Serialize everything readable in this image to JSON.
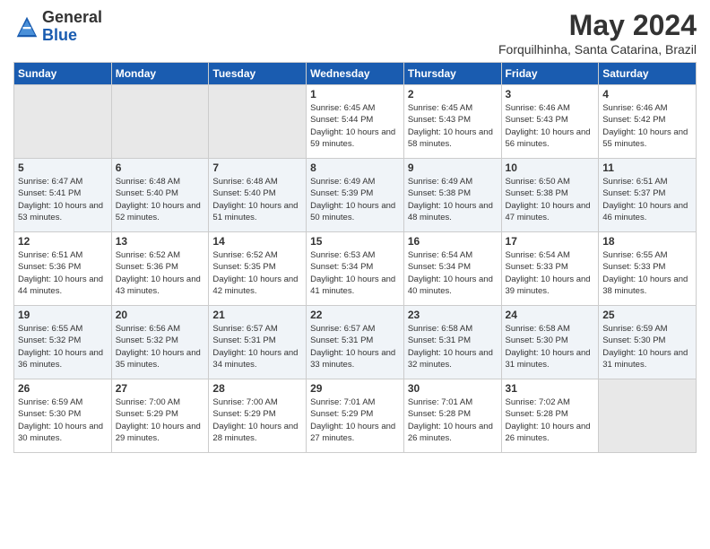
{
  "logo": {
    "general": "General",
    "blue": "Blue"
  },
  "title": {
    "month_year": "May 2024",
    "location": "Forquilhinha, Santa Catarina, Brazil"
  },
  "headers": [
    "Sunday",
    "Monday",
    "Tuesday",
    "Wednesday",
    "Thursday",
    "Friday",
    "Saturday"
  ],
  "weeks": [
    [
      {
        "day": "",
        "info": ""
      },
      {
        "day": "",
        "info": ""
      },
      {
        "day": "",
        "info": ""
      },
      {
        "day": "1",
        "info": "Sunrise: 6:45 AM\nSunset: 5:44 PM\nDaylight: 10 hours\nand 59 minutes."
      },
      {
        "day": "2",
        "info": "Sunrise: 6:45 AM\nSunset: 5:43 PM\nDaylight: 10 hours\nand 58 minutes."
      },
      {
        "day": "3",
        "info": "Sunrise: 6:46 AM\nSunset: 5:43 PM\nDaylight: 10 hours\nand 56 minutes."
      },
      {
        "day": "4",
        "info": "Sunrise: 6:46 AM\nSunset: 5:42 PM\nDaylight: 10 hours\nand 55 minutes."
      }
    ],
    [
      {
        "day": "5",
        "info": "Sunrise: 6:47 AM\nSunset: 5:41 PM\nDaylight: 10 hours\nand 53 minutes."
      },
      {
        "day": "6",
        "info": "Sunrise: 6:48 AM\nSunset: 5:40 PM\nDaylight: 10 hours\nand 52 minutes."
      },
      {
        "day": "7",
        "info": "Sunrise: 6:48 AM\nSunset: 5:40 PM\nDaylight: 10 hours\nand 51 minutes."
      },
      {
        "day": "8",
        "info": "Sunrise: 6:49 AM\nSunset: 5:39 PM\nDaylight: 10 hours\nand 50 minutes."
      },
      {
        "day": "9",
        "info": "Sunrise: 6:49 AM\nSunset: 5:38 PM\nDaylight: 10 hours\nand 48 minutes."
      },
      {
        "day": "10",
        "info": "Sunrise: 6:50 AM\nSunset: 5:38 PM\nDaylight: 10 hours\nand 47 minutes."
      },
      {
        "day": "11",
        "info": "Sunrise: 6:51 AM\nSunset: 5:37 PM\nDaylight: 10 hours\nand 46 minutes."
      }
    ],
    [
      {
        "day": "12",
        "info": "Sunrise: 6:51 AM\nSunset: 5:36 PM\nDaylight: 10 hours\nand 44 minutes."
      },
      {
        "day": "13",
        "info": "Sunrise: 6:52 AM\nSunset: 5:36 PM\nDaylight: 10 hours\nand 43 minutes."
      },
      {
        "day": "14",
        "info": "Sunrise: 6:52 AM\nSunset: 5:35 PM\nDaylight: 10 hours\nand 42 minutes."
      },
      {
        "day": "15",
        "info": "Sunrise: 6:53 AM\nSunset: 5:34 PM\nDaylight: 10 hours\nand 41 minutes."
      },
      {
        "day": "16",
        "info": "Sunrise: 6:54 AM\nSunset: 5:34 PM\nDaylight: 10 hours\nand 40 minutes."
      },
      {
        "day": "17",
        "info": "Sunrise: 6:54 AM\nSunset: 5:33 PM\nDaylight: 10 hours\nand 39 minutes."
      },
      {
        "day": "18",
        "info": "Sunrise: 6:55 AM\nSunset: 5:33 PM\nDaylight: 10 hours\nand 38 minutes."
      }
    ],
    [
      {
        "day": "19",
        "info": "Sunrise: 6:55 AM\nSunset: 5:32 PM\nDaylight: 10 hours\nand 36 minutes."
      },
      {
        "day": "20",
        "info": "Sunrise: 6:56 AM\nSunset: 5:32 PM\nDaylight: 10 hours\nand 35 minutes."
      },
      {
        "day": "21",
        "info": "Sunrise: 6:57 AM\nSunset: 5:31 PM\nDaylight: 10 hours\nand 34 minutes."
      },
      {
        "day": "22",
        "info": "Sunrise: 6:57 AM\nSunset: 5:31 PM\nDaylight: 10 hours\nand 33 minutes."
      },
      {
        "day": "23",
        "info": "Sunrise: 6:58 AM\nSunset: 5:31 PM\nDaylight: 10 hours\nand 32 minutes."
      },
      {
        "day": "24",
        "info": "Sunrise: 6:58 AM\nSunset: 5:30 PM\nDaylight: 10 hours\nand 31 minutes."
      },
      {
        "day": "25",
        "info": "Sunrise: 6:59 AM\nSunset: 5:30 PM\nDaylight: 10 hours\nand 31 minutes."
      }
    ],
    [
      {
        "day": "26",
        "info": "Sunrise: 6:59 AM\nSunset: 5:30 PM\nDaylight: 10 hours\nand 30 minutes."
      },
      {
        "day": "27",
        "info": "Sunrise: 7:00 AM\nSunset: 5:29 PM\nDaylight: 10 hours\nand 29 minutes."
      },
      {
        "day": "28",
        "info": "Sunrise: 7:00 AM\nSunset: 5:29 PM\nDaylight: 10 hours\nand 28 minutes."
      },
      {
        "day": "29",
        "info": "Sunrise: 7:01 AM\nSunset: 5:29 PM\nDaylight: 10 hours\nand 27 minutes."
      },
      {
        "day": "30",
        "info": "Sunrise: 7:01 AM\nSunset: 5:28 PM\nDaylight: 10 hours\nand 26 minutes."
      },
      {
        "day": "31",
        "info": "Sunrise: 7:02 AM\nSunset: 5:28 PM\nDaylight: 10 hours\nand 26 minutes."
      },
      {
        "day": "",
        "info": ""
      }
    ]
  ]
}
